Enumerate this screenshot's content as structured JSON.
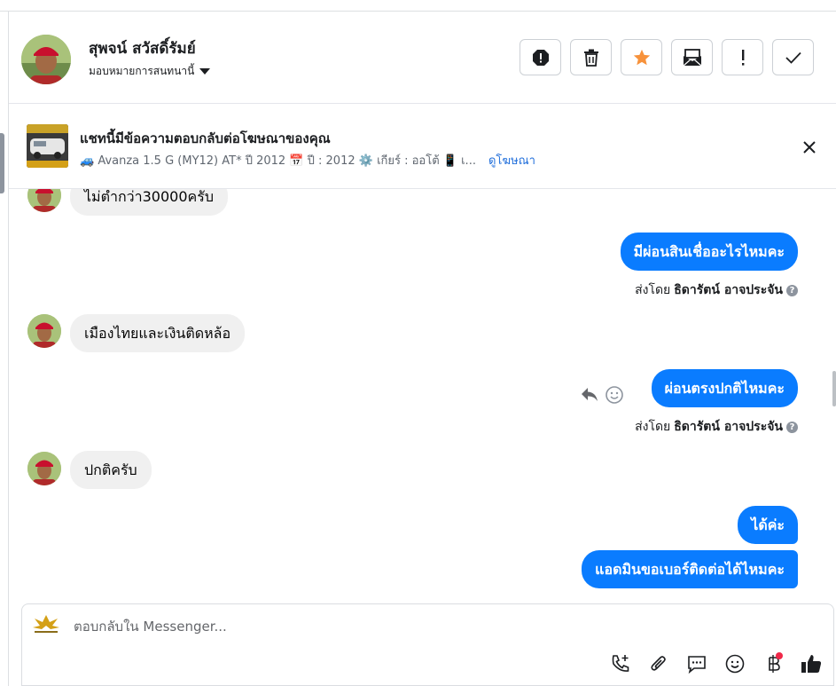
{
  "header": {
    "contact_name": "สุพจน์ สวัสดิ์รัมย์",
    "assign_label": "มอบหมายการสนทนานี้"
  },
  "banner": {
    "title": "แชทนี้มีข้อความตอบกลับต่อโฆษณาของคุณ",
    "subtitle": "🚙 Avanza 1.5 G (MY12) AT* ปี 2012 📅 ปี : 2012 ⚙️ เกียร์ : ออโต้ 📱 เ...",
    "link": "ดูโฆษณา"
  },
  "messages": {
    "m1": "ไม่ต่ำกว่า30000ครับ",
    "m2": "มีผ่อนสินเชื่ออะไรไหมคะ",
    "m3": "เมืองไทยและเงินติดหล้อ",
    "m4": "ผ่อนตรงปกติไหมคะ",
    "m5": "ปกติครับ",
    "m6": "ได้ค่ะ",
    "m7": "แอดมินขอเบอร์ติดต่อได้ไหมคะ"
  },
  "sent_by": {
    "prefix": "ส่งโดย",
    "name": "ธิดารัตน์ อาจประจัน"
  },
  "composer": {
    "placeholder": "ตอบกลับใน Messenger..."
  },
  "icons": {
    "report": "exclamation-octagon-icon",
    "delete": "trash-icon",
    "star": "star-icon",
    "mark_unread": "envelope-icon",
    "spam": "exclamation-icon",
    "done": "checkmark-icon",
    "close": "close-icon",
    "reply": "reply-arrow-icon",
    "react": "smiley-icon",
    "call": "phone-plus-icon",
    "attach": "paperclip-icon",
    "saved_replies": "chat-bubble-icon",
    "emoji": "smiley-icon",
    "payment": "baht-icon",
    "like": "thumbs-up-icon"
  },
  "colors": {
    "outgoing_bubble": "#0a7cff",
    "incoming_bubble": "#f0f0f0",
    "star": "#f7923b",
    "link": "#216fdb",
    "notification": "#f02849"
  }
}
